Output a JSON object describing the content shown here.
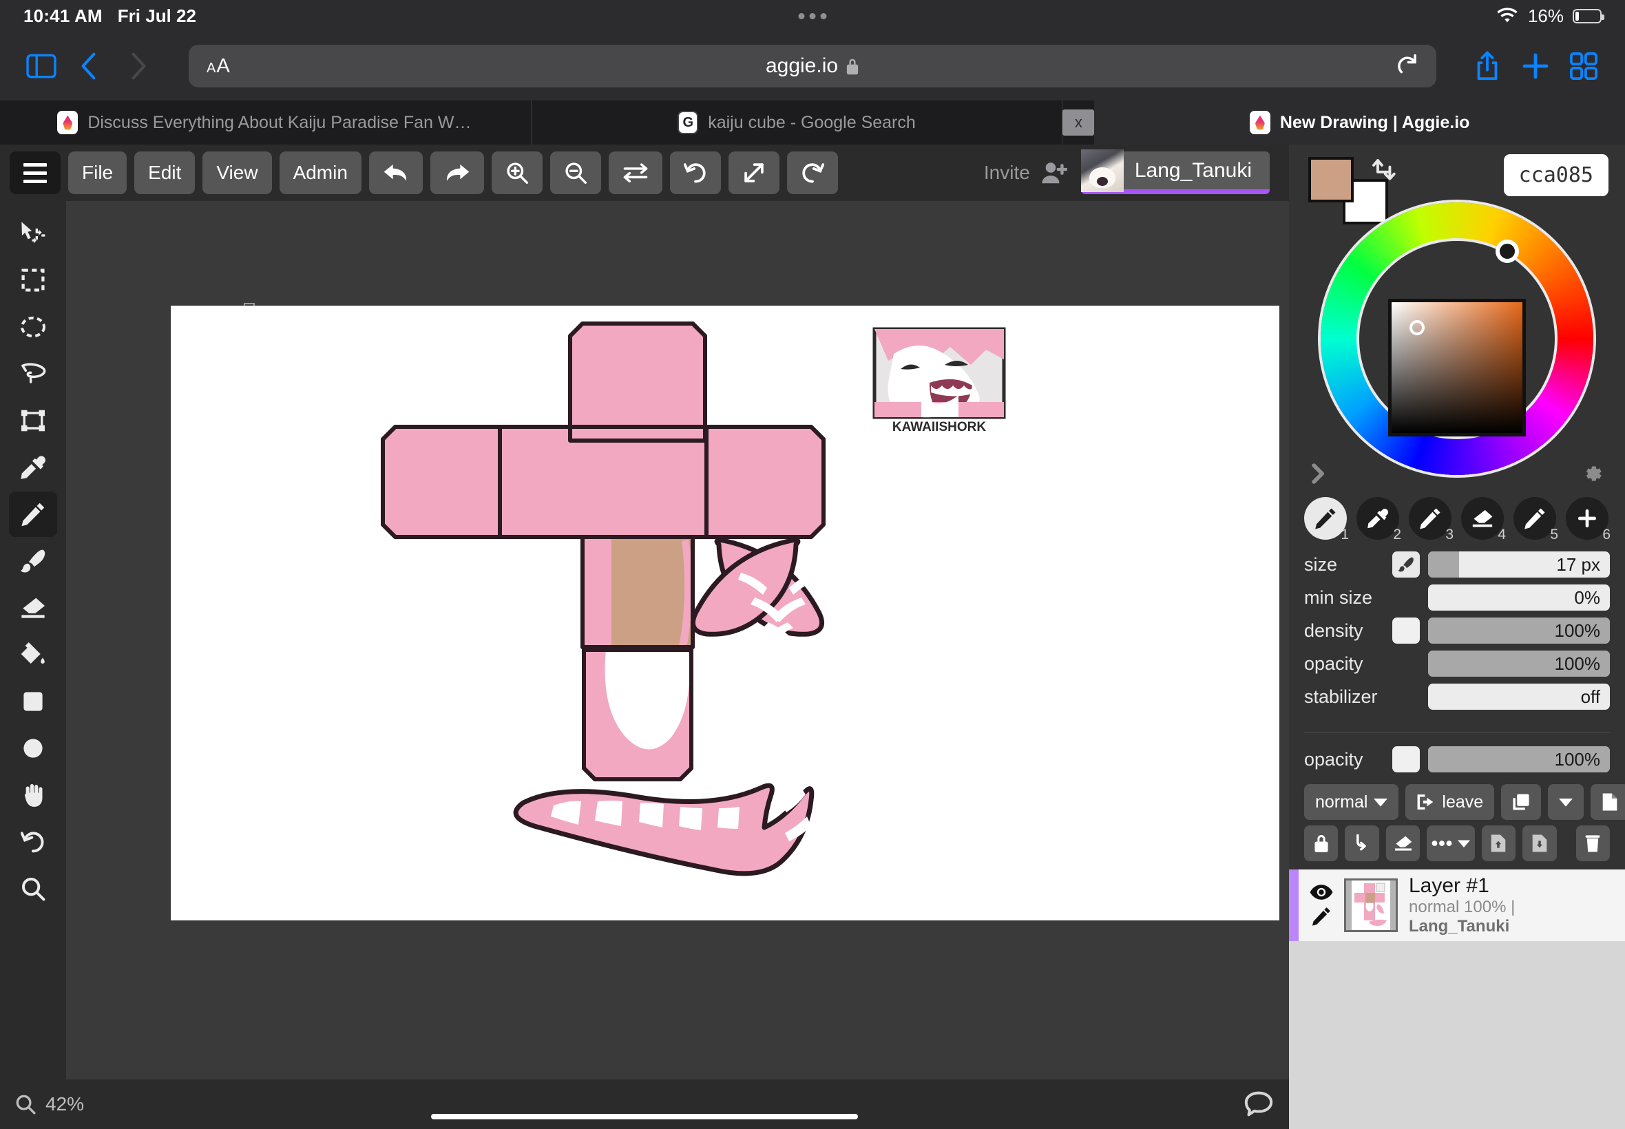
{
  "statusbar": {
    "time": "10:41 AM",
    "date": "Fri Jul 22",
    "battery_pct": "16%",
    "wifi_icon": "wifi-icon"
  },
  "browser": {
    "url": "aggie.io",
    "text_size_small": "A",
    "text_size_large": "A",
    "lock_icon": "lock-icon",
    "reload_icon": "reload-icon",
    "sidebar_icon": "sidebar-icon",
    "back_icon": "back-chevron-icon",
    "forward_icon": "forward-chevron-icon",
    "share_icon": "share-icon",
    "newtab_icon": "plus-icon",
    "tabsview_icon": "tab-overview-icon",
    "tabs": [
      {
        "title": "Discuss Everything About Kaiju Paradise Fan Wiki | Fa...",
        "favicon": "fandom-flame-icon",
        "active": false
      },
      {
        "title": "kaiju cube - Google Search",
        "favicon": "google-icon",
        "active": false
      },
      {
        "title": "New Drawing | Aggie.io",
        "favicon": "aggie-flame-icon",
        "active": true
      }
    ],
    "close_label": "x"
  },
  "toolbar": {
    "menu_icon": "hamburger-icon",
    "items": [
      {
        "label": "File",
        "name": "file-menu"
      },
      {
        "label": "Edit",
        "name": "edit-menu"
      },
      {
        "label": "View",
        "name": "view-menu"
      },
      {
        "label": "Admin",
        "name": "admin-menu"
      }
    ],
    "icon_buttons": [
      {
        "name": "undo-button",
        "icon": "undo-arrow-icon"
      },
      {
        "name": "redo-button",
        "icon": "redo-arrow-icon"
      },
      {
        "name": "zoom-in-button",
        "icon": "zoom-in-icon"
      },
      {
        "name": "zoom-out-button",
        "icon": "zoom-out-icon"
      },
      {
        "name": "flip-button",
        "icon": "swap-arrows-icon"
      },
      {
        "name": "rotate-left-button",
        "icon": "rotate-ccw-icon"
      },
      {
        "name": "fit-screen-button",
        "icon": "expand-diagonal-icon"
      },
      {
        "name": "rotate-right-button",
        "icon": "rotate-cw-icon"
      }
    ],
    "invite_label": "Invite",
    "invite_icon": "add-person-icon",
    "username": "Lang_Tanuki",
    "user_color": "#a855f7"
  },
  "tools": [
    {
      "name": "move-tool",
      "icon": "cursor-move-icon",
      "active": false
    },
    {
      "name": "rect-select-tool",
      "icon": "rectangle-select-icon",
      "active": false
    },
    {
      "name": "ellipse-select-tool",
      "icon": "ellipse-select-icon",
      "active": false
    },
    {
      "name": "lasso-select-tool",
      "icon": "lasso-icon",
      "active": false
    },
    {
      "name": "transform-tool",
      "icon": "transform-box-icon",
      "active": false
    },
    {
      "name": "eyedropper-tool",
      "icon": "eyedropper-icon",
      "active": false
    },
    {
      "name": "pencil-tool",
      "icon": "pencil-icon",
      "active": true
    },
    {
      "name": "brush-tool",
      "icon": "paintbrush-icon",
      "active": false
    },
    {
      "name": "eraser-tool",
      "icon": "eraser-icon",
      "active": false
    },
    {
      "name": "fill-tool",
      "icon": "paint-bucket-icon",
      "active": false
    },
    {
      "name": "rectangle-shape-tool",
      "icon": "square-icon",
      "active": false
    },
    {
      "name": "ellipse-shape-tool",
      "icon": "circle-icon",
      "active": false
    },
    {
      "name": "pan-tool",
      "icon": "hand-icon",
      "active": false
    },
    {
      "name": "rotate-canvas-tool",
      "icon": "rotate-ccw-icon",
      "active": false
    },
    {
      "name": "zoom-tool",
      "icon": "magnifier-icon",
      "active": false
    }
  ],
  "colorpanel": {
    "hex": "cca085",
    "primary_color": "#cca085",
    "secondary_color": "#ffffff",
    "swap_icon": "swap-colors-icon",
    "expand_icon": "chevron-right-icon",
    "settings_icon": "gear-icon"
  },
  "brush_slots": [
    {
      "num": "1",
      "icon": "pencil-icon",
      "active": true
    },
    {
      "num": "2",
      "icon": "eyedropper-icon",
      "active": false
    },
    {
      "num": "3",
      "icon": "pencil-icon",
      "active": false
    },
    {
      "num": "4",
      "icon": "eraser-icon",
      "active": false
    },
    {
      "num": "5",
      "icon": "pencil-icon",
      "active": false
    },
    {
      "num": "6",
      "icon": "plus-icon",
      "active": false
    }
  ],
  "brush_settings": [
    {
      "label": "size",
      "value": "17 px",
      "fill_pct": 17,
      "icon": "paintbrush-icon"
    },
    {
      "label": "min size",
      "value": "0%",
      "fill_pct": 0,
      "icon": null
    },
    {
      "label": "density",
      "value": "100%",
      "fill_pct": 100,
      "icon": "blank-swatch-icon"
    },
    {
      "label": "opacity",
      "value": "100%",
      "fill_pct": 100,
      "icon": null
    },
    {
      "label": "stabilizer",
      "value": "off",
      "fill_pct": 0,
      "icon": null
    }
  ],
  "layerpanel": {
    "opacity_label": "opacity",
    "opacity_value": "100%",
    "opacity_pct": 100,
    "opacity_icon": "blank-swatch-icon",
    "blend_mode": "normal",
    "blend_caret": "caret-down-icon",
    "leave_label": "leave",
    "leave_icon": "exit-door-icon",
    "duplicate_icon": "duplicate-layers-icon",
    "duplicate_caret": "caret-down-icon",
    "newlayer_icon": "new-page-icon",
    "lock_icon": "lock-icon",
    "merge_down_icon": "merge-down-arrow-icon",
    "clear_icon": "eraser-icon",
    "more_icon": "ellipsis-icon",
    "more_caret": "caret-down-icon",
    "import_icon": "file-up-icon",
    "export_icon": "file-down-icon",
    "delete_icon": "trash-icon",
    "layers": [
      {
        "name": "Layer #1",
        "meta_mode": "normal 100%",
        "meta_sep": "|",
        "meta_user": "Lang_Tanuki",
        "visible_icon": "eye-icon",
        "edit_icon": "pencil-icon",
        "accent": "#bb86fc"
      }
    ]
  },
  "canvas": {
    "zoom_level": "42%",
    "zoom_icon": "magnifier-icon",
    "chat_icon": "chat-bubble-icon",
    "artwork_title": "papercraft cube net",
    "reference_caption": "KAWAIISHORK",
    "colors": {
      "pink": "#f2a8c0",
      "pink_dark": "#eb9ab4",
      "tan": "#cca085",
      "outline": "#2b1a22",
      "white": "#ffffff"
    }
  }
}
